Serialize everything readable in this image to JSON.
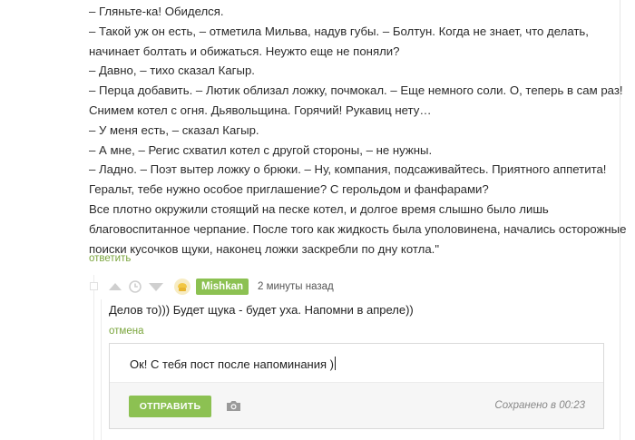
{
  "story": {
    "lines": [
      "– Гляньте-ка! Обиделся.",
      "– Такой уж он есть, – отметила Мильва, надув губы. – Болтун. Когда не знает, что делать,",
      "начинает болтать и обижаться. Неужто еще не поняли?",
      "– Давно, – тихо сказал Кагыр.",
      "– Перца добавить. – Лютик облизал ложку, почмокал. – Еще немного соли. О, теперь в сам раз!",
      "Снимем котел с огня. Дьявольщина. Горячий! Рукавиц нету…",
      "– У меня есть, – сказал Кагыр.",
      "– А мне, – Регис схватил котел с другой стороны, – не нужны.",
      "– Ладно. – Поэт вытер ложку о брюки. – Ну, компания, подсаживайтесь. Приятного аппетита!",
      "Геральт, тебе нужно особое приглашение? С герольдом и фанфарами?",
      "Все плотно окружили стоящий на песке котел, и долгое время слышно было лишь",
      "благовоспитанное черпание. После того как жидкость была уполовинена, начались осторожные",
      "поиски кусочков щуки, наконец ложки заскребли по дну котла.\""
    ],
    "reply_label": "ответить"
  },
  "comment": {
    "icons": {
      "collapse": "collapse-box-icon",
      "vote_up": "vote-up-icon",
      "save_later": "clock-icon",
      "vote_down": "vote-down-icon",
      "avatar": "avatar-icon"
    },
    "username": "Mishkan",
    "time": "2 минуты назад",
    "text": "Делов то))) Будет щука - будет уха. Напомни в апреле))",
    "cancel_label": "отмена"
  },
  "editor": {
    "value": "Ок! С тебя пост после напоминания )",
    "send_label": "ОТПРАВИТЬ",
    "attach_icon": "camera-icon",
    "saved_status": "Сохранено в 00:23"
  },
  "colors": {
    "accent": "#8cc152",
    "link": "#7aa53c",
    "icon_gray": "#cfcfcf"
  }
}
